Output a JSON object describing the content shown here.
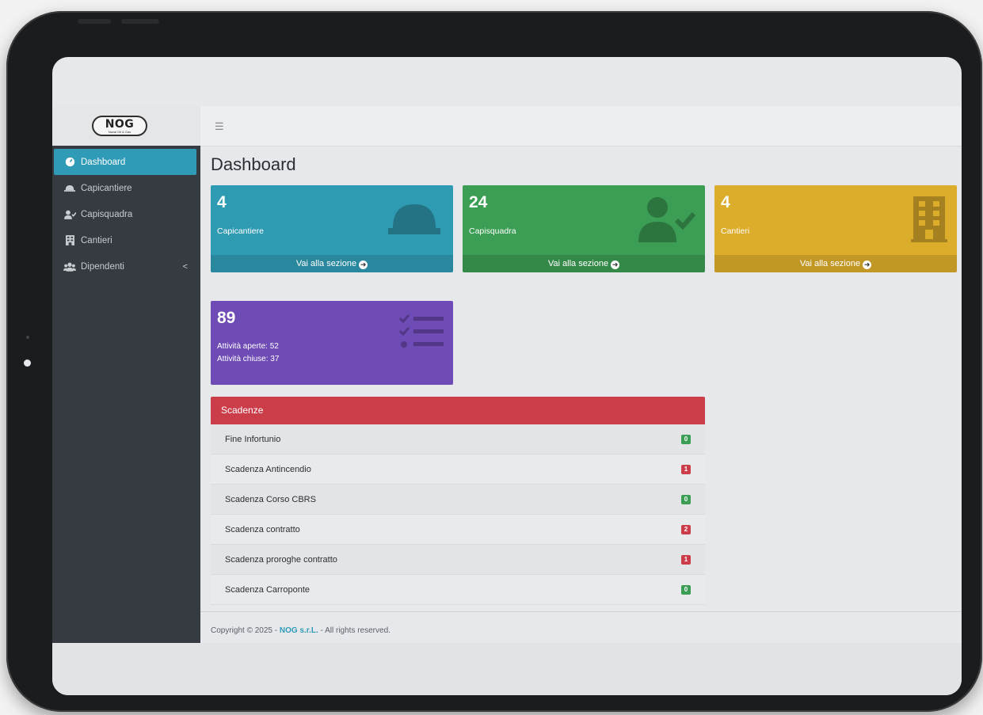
{
  "app": {
    "logo_text": "NOG",
    "logo_subtitle": "Naval Oil & Gas",
    "page_title": "Dashboard",
    "menu_icon": "hamburger-icon"
  },
  "sidebar": {
    "items": [
      {
        "label": "Dashboard",
        "icon": "dashboard-icon",
        "active": true
      },
      {
        "label": "Capicantiere",
        "icon": "hardhat-icon"
      },
      {
        "label": "Capisquadra",
        "icon": "user-check-icon"
      },
      {
        "label": "Cantieri",
        "icon": "building-icon"
      },
      {
        "label": "Dipendenti",
        "icon": "users-icon",
        "caret": "<"
      }
    ]
  },
  "cards": {
    "capicantiere": {
      "count": "4",
      "label": "Capicantiere",
      "link": "Vai alla sezione",
      "color": "#2f9bb3"
    },
    "capisquadra": {
      "count": "24",
      "label": "Capisquadra",
      "link": "Vai alla sezione",
      "color": "#3c9d54"
    },
    "cantieri": {
      "count": "4",
      "label": "Cantieri",
      "link": "Vai alla sezione",
      "color": "#dcac2b"
    },
    "attivita": {
      "count": "89",
      "open": "Attività aperte: 52",
      "closed": "Attività chiuse: 37",
      "color": "#6e4bb5"
    }
  },
  "scadenze": {
    "title": "Scadenze",
    "color": "#cc3d4a",
    "items": [
      {
        "label": "Fine Infortunio",
        "count": "0",
        "status": "ok"
      },
      {
        "label": "Scadenza Antincendio",
        "count": "1",
        "status": "alert"
      },
      {
        "label": "Scadenza Corso CBRS",
        "count": "0",
        "status": "ok"
      },
      {
        "label": "Scadenza contratto",
        "count": "2",
        "status": "alert"
      },
      {
        "label": "Scadenza proroghe contratto",
        "count": "1",
        "status": "alert"
      },
      {
        "label": "Scadenza Carroponte",
        "count": "0",
        "status": "ok"
      }
    ]
  },
  "footer": {
    "prefix": "Copyright © 2025 - ",
    "company": "NOG s.r.L.",
    "suffix": " - All rights reserved."
  }
}
